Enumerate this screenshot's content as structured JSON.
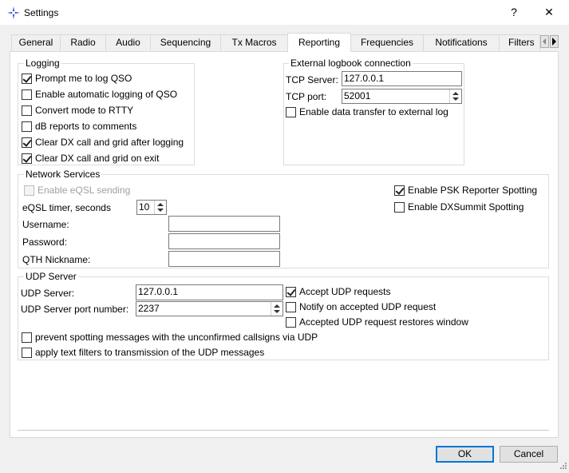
{
  "window": {
    "title": "Settings",
    "help_glyph": "?",
    "close_glyph": "✕"
  },
  "tabs": [
    {
      "label": "General"
    },
    {
      "label": "Radio"
    },
    {
      "label": "Audio"
    },
    {
      "label": "Sequencing"
    },
    {
      "label": "Tx Macros"
    },
    {
      "label": "Reporting",
      "active": true
    },
    {
      "label": "Frequencies"
    },
    {
      "label": "Notifications"
    },
    {
      "label": "Filters"
    }
  ],
  "logging": {
    "title": "Logging",
    "items": [
      {
        "label": "Prompt me to log QSO",
        "checked": true
      },
      {
        "label": "Enable automatic logging of QSO",
        "checked": false
      },
      {
        "label": "Convert mode to RTTY",
        "checked": false
      },
      {
        "label": "dB reports to comments",
        "checked": false
      },
      {
        "label": "Clear DX call and grid after logging",
        "checked": true
      },
      {
        "label": "Clear DX call and grid on exit",
        "checked": true
      }
    ]
  },
  "external": {
    "title": "External logbook connection",
    "tcp_server_label": "TCP Server:",
    "tcp_server_value": "127.0.0.1",
    "tcp_port_label": "TCP port:",
    "tcp_port_value": "52001",
    "enable_transfer_label": "Enable data transfer to external log",
    "enable_transfer_checked": false
  },
  "network": {
    "title": "Network Services",
    "eqsl_label": "Enable eQSL sending",
    "eqsl_checked": false,
    "eqsl_timer_label": "eQSL timer, seconds",
    "eqsl_timer_value": "10",
    "username_label": "Username:",
    "username_value": "",
    "password_label": "Password:",
    "password_value": "",
    "qth_label": "QTH Nickname:",
    "qth_value": "",
    "psk_label": "Enable PSK Reporter Spotting",
    "psk_checked": true,
    "dxsummit_label": "Enable DXSummit Spotting",
    "dxsummit_checked": false
  },
  "udp": {
    "title": "UDP Server",
    "server_label": "UDP Server:",
    "server_value": "127.0.0.1",
    "port_label": "UDP Server port number:",
    "port_value": "2237",
    "accept_label": "Accept UDP requests",
    "accept_checked": true,
    "notify_label": "Notify on accepted UDP request",
    "notify_checked": false,
    "restore_label": "Accepted UDP request restores window",
    "restore_checked": false,
    "prevent_label": "prevent spotting messages with the unconfirmed callsigns via UDP",
    "prevent_checked": false,
    "textfilter_label": "apply text filters to transmission of the UDP messages",
    "textfilter_checked": false
  },
  "buttons": {
    "ok": "OK",
    "cancel": "Cancel"
  },
  "colors": {
    "accent": "#0078d7",
    "app_icon": "#3b4fd8"
  }
}
